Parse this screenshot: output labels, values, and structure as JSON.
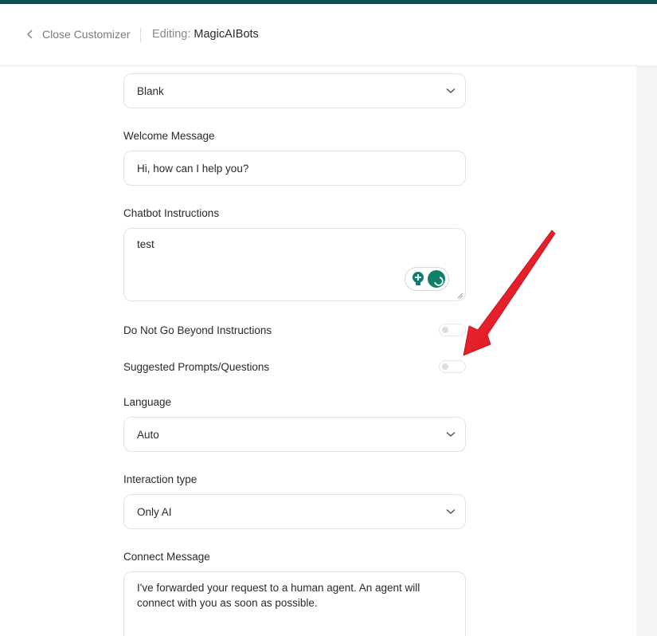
{
  "header": {
    "back_label": "Close Customizer",
    "editing_prefix": "Editing:",
    "editing_name": "MagicAIBots"
  },
  "form": {
    "template_select": {
      "value": "Blank"
    },
    "welcome": {
      "label": "Welcome Message",
      "value": "Hi, how can I help you?"
    },
    "instructions": {
      "label": "Chatbot Instructions",
      "value": "test"
    },
    "toggle_beyond": {
      "label": "Do Not Go Beyond Instructions",
      "on": false
    },
    "toggle_prompts": {
      "label": "Suggested Prompts/Questions",
      "on": false
    },
    "language": {
      "label": "Language",
      "value": "Auto"
    },
    "interaction": {
      "label": "Interaction type",
      "value": "Only AI"
    },
    "connect": {
      "label": "Connect Message",
      "value": "I've forwarded your request to a human agent. An agent will connect with you as soon as possible."
    }
  },
  "colors": {
    "accent": "#0f4e4c",
    "arrow": "#e8131b",
    "grammar_green": "#0f7f6a"
  },
  "icons": {
    "back": "chevron-left-icon",
    "select": "chevron-down-icon"
  }
}
